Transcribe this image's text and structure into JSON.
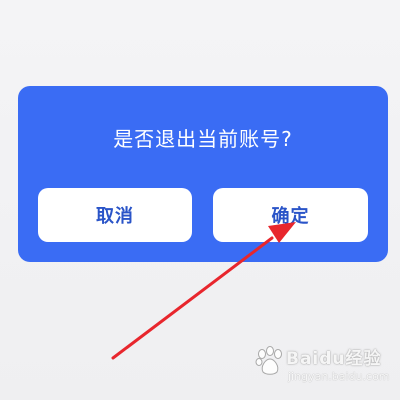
{
  "dialog": {
    "message": "是否退出当前账号?",
    "cancel_label": "取消",
    "confirm_label": "确定"
  },
  "watermark": {
    "brand": "Baidu经验",
    "url": "jingyan.baidu.com"
  },
  "colors": {
    "dialog_background": "#3a6cf4",
    "button_background": "#ffffff",
    "button_text": "#2a54c8",
    "arrow": "#e8262d"
  },
  "icons": {
    "annotation": "red-arrow-icon",
    "watermark_logo": "baidu-paw-icon"
  }
}
